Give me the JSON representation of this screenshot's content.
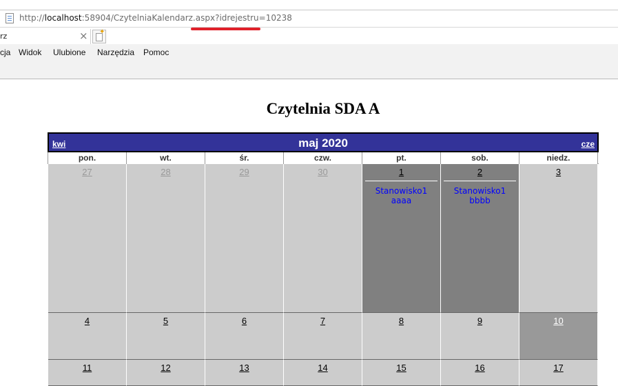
{
  "browser": {
    "url_prefix": "http://",
    "url_host": "localhost",
    "url_rest": ":58904/CzytelniaKalendarz.aspx?idrejestru=10238",
    "tab_title": "rz",
    "tab_close": "×",
    "menu": [
      "cja",
      "Widok",
      "Ulubione",
      "Narzędzia",
      "Pomoc"
    ],
    "highlight_color": "#e0202a"
  },
  "page": {
    "title": "Czytelnia SDA A"
  },
  "calendar": {
    "month_title": "maj 2020",
    "prev_label": "kwi",
    "next_label": "cze",
    "header_color": "#333399",
    "weekdays": [
      "pon.",
      "wt.",
      "śr.",
      "czw.",
      "pt.",
      "sob.",
      "niedz."
    ],
    "weeks": [
      [
        {
          "day": "27",
          "kind": "other",
          "events": []
        },
        {
          "day": "28",
          "kind": "other",
          "events": []
        },
        {
          "day": "29",
          "kind": "other",
          "events": []
        },
        {
          "day": "30",
          "kind": "other",
          "events": []
        },
        {
          "day": "1",
          "kind": "event",
          "events": [
            "Stanowisko1",
            "aaaa"
          ]
        },
        {
          "day": "2",
          "kind": "event",
          "events": [
            "Stanowisko1",
            "bbbb"
          ]
        },
        {
          "day": "3",
          "kind": "normal",
          "events": []
        }
      ],
      [
        {
          "day": "4",
          "kind": "normal",
          "events": []
        },
        {
          "day": "5",
          "kind": "normal",
          "events": []
        },
        {
          "day": "6",
          "kind": "normal",
          "events": []
        },
        {
          "day": "7",
          "kind": "normal",
          "events": []
        },
        {
          "day": "8",
          "kind": "normal",
          "events": []
        },
        {
          "day": "9",
          "kind": "normal",
          "events": []
        },
        {
          "day": "10",
          "kind": "today",
          "events": []
        }
      ],
      [
        {
          "day": "11",
          "kind": "normal",
          "events": []
        },
        {
          "day": "12",
          "kind": "normal",
          "events": []
        },
        {
          "day": "13",
          "kind": "normal",
          "events": []
        },
        {
          "day": "14",
          "kind": "normal",
          "events": []
        },
        {
          "day": "15",
          "kind": "normal",
          "events": []
        },
        {
          "day": "16",
          "kind": "normal",
          "events": []
        },
        {
          "day": "17",
          "kind": "normal",
          "events": []
        }
      ]
    ]
  }
}
